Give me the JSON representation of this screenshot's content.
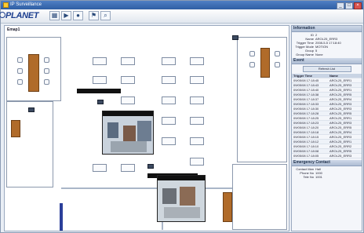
{
  "window": {
    "title": "IP Surveillance"
  },
  "toolbar": {
    "logo_text": "PLANET",
    "buttons": [
      "grid-icon",
      "play-icon",
      "record-icon",
      "alarm-icon",
      "search-icon"
    ]
  },
  "map": {
    "label": "Emap1"
  },
  "panel": {
    "info_header": "Information",
    "info": [
      {
        "k": "ID",
        "v": "2"
      },
      {
        "k": "Name",
        "v": "AROL25_ERR3"
      },
      {
        "k": "Trigger Time",
        "v": "2008-5-5 17:18:40"
      },
      {
        "k": "Trigger Mode",
        "v": "MOTION"
      },
      {
        "k": "Group",
        "v": "5"
      },
      {
        "k": "Group Name",
        "v": "None"
      }
    ],
    "event_header": "Event",
    "event_button": "Refresh List",
    "columns": [
      "Trigger Time",
      "Name"
    ],
    "rows": [
      [
        "09/05/08 17:18:45",
        "AROL25_ERR1"
      ],
      [
        "09/05/08 17:18:43",
        "AROL25_ERR3"
      ],
      [
        "09/05/08 17:18:40",
        "AROL25_ERR1"
      ],
      [
        "09/05/08 17:18:38",
        "AROL25_ERR5"
      ],
      [
        "09/05/08 17:18:37",
        "AROL25_ERR4"
      ],
      [
        "09/05/08 17:18:33",
        "AROL25_ERR3"
      ],
      [
        "09/05/08 17:18:30",
        "AROL25_ERR3"
      ],
      [
        "09/05/08 17:18:28",
        "AROL25_ERR5"
      ],
      [
        "09/05/08 17:18:25",
        "AROL25_ERR1"
      ],
      [
        "09/05/08 17:18:23",
        "AROL25_ERR3"
      ],
      [
        "09/05/08 17:18:20",
        "AROL25_ERR5"
      ],
      [
        "09/05/08 17:18:18",
        "AROL25_ERR4"
      ],
      [
        "09/05/08 17:18:15",
        "AROL25_ERR3"
      ],
      [
        "09/05/08 17:18:12",
        "AROL25_ERR1"
      ],
      [
        "09/05/08 17:18:10",
        "AROL25_ERR2"
      ],
      [
        "09/05/08 17:18:08",
        "AROL25_ERR5"
      ],
      [
        "09/05/08 17:18:05",
        "AROL25_ERR3"
      ]
    ],
    "status_header": "Emergency Contact",
    "status": [
      {
        "k": "Contact Man",
        "v": "Hall"
      },
      {
        "k": "Phone No",
        "v": "1000"
      },
      {
        "k": "Tele No",
        "v": "1001"
      }
    ]
  }
}
